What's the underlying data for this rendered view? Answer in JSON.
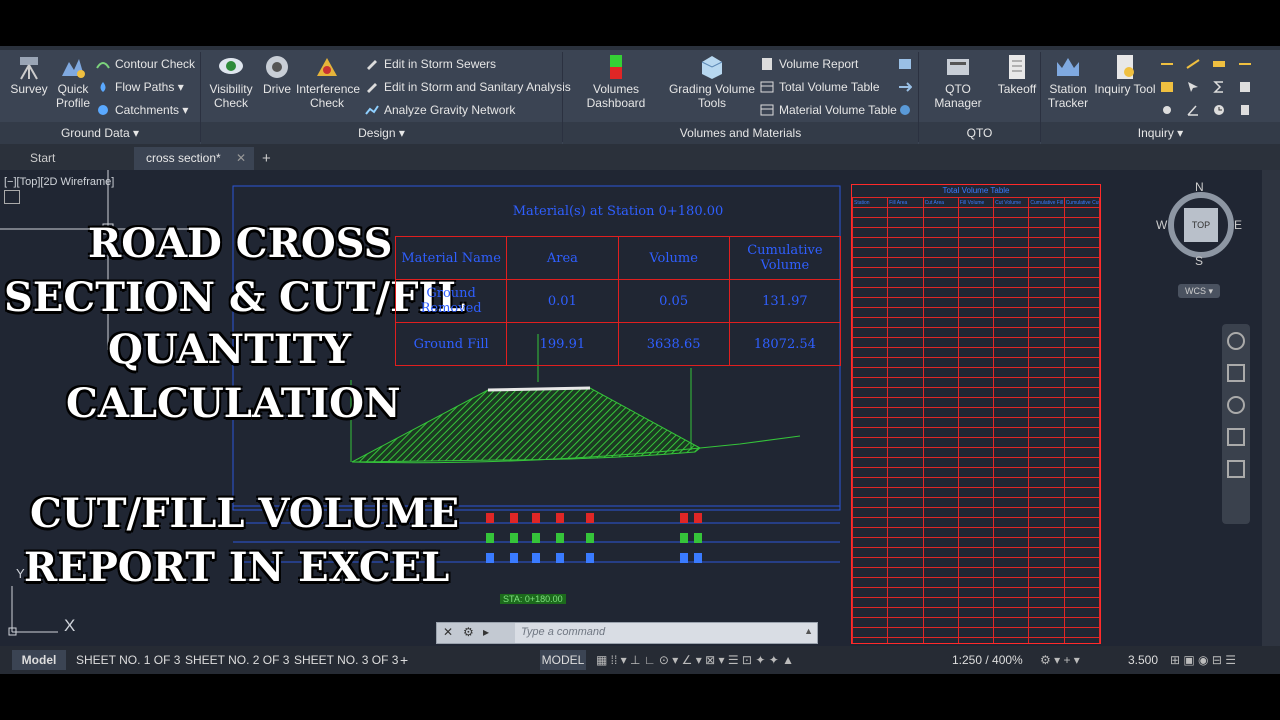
{
  "ribbon": {
    "ground_data": {
      "title": "Ground Data",
      "survey": "Survey",
      "quick_profile_1": "Quick",
      "quick_profile_2": "Profile",
      "contour_check": "Contour Check",
      "flow_paths": "Flow Paths",
      "catchments": "Catchments"
    },
    "design": {
      "title": "Design",
      "visibility_1": "Visibility",
      "visibility_2": "Check",
      "drive": "Drive",
      "interference_1": "Interference",
      "interference_2": "Check",
      "edit_storm_sewers": "Edit in Storm Sewers",
      "edit_storm_sanitary": "Edit in Storm and Sanitary Analysis",
      "analyze_gravity": "Analyze Gravity Network"
    },
    "volumes": {
      "title": "Volumes and Materials",
      "dashboard": "Volumes Dashboard",
      "grading_1": "Grading Volume",
      "grading_2": "Tools",
      "volume_report": "Volume Report",
      "total_volume_table": "Total Volume Table",
      "material_volume_table": "Material Volume Table"
    },
    "qto": {
      "title": "QTO",
      "manager": "QTO Manager",
      "takeoff": "Takeoff"
    },
    "inquiry": {
      "title": "Inquiry",
      "station_1": "Station",
      "station_2": "Tracker",
      "inquiry_tool": "Inquiry Tool"
    }
  },
  "file_tabs": {
    "start": "Start",
    "active": "cross section*"
  },
  "viewport": {
    "label": "[−][Top][2D Wireframe]",
    "axis_y": "Y",
    "axis_x": "X"
  },
  "overlay": {
    "line1": "ROAD CROSS",
    "line2": "SECTION & CUT/FIL",
    "line3": "QUANTITY",
    "line4": "CALCULATION",
    "line5": "CUT/FILL VOLUME",
    "line6": "REPORT IN EXCEL"
  },
  "viewcube": {
    "n": "N",
    "s": "S",
    "e": "E",
    "w": "W",
    "top": "TOP",
    "wcs": "WCS"
  },
  "material_table": {
    "title": "Material(s) at Station 0+180.00",
    "headers": [
      "Material Name",
      "Area",
      "Volume",
      "Cumulative Volume"
    ],
    "rows": [
      [
        "Ground Removed",
        "0.01",
        "0.05",
        "131.97"
      ],
      [
        "Ground Fill",
        "199.91",
        "3638.65",
        "18072.54"
      ]
    ]
  },
  "volume_table": {
    "title": "Total Volume Table",
    "headers": [
      "Station",
      "Fill Area",
      "Cut Area",
      "Fill Volume",
      "Cut Volume",
      "Cumulative Fill Vol",
      "Cumulative Cut Vol"
    ]
  },
  "drawing": {
    "station_label": "STA: 0+180.00",
    "green_tick": "0+180"
  },
  "command": {
    "placeholder": "Type a command"
  },
  "layout_tabs": [
    "Model",
    "SHEET NO. 1 OF 3",
    "SHEET NO. 2 OF 3",
    "SHEET NO. 3 OF 3"
  ],
  "status": {
    "model": "MODEL",
    "scale": "1:250 / 400%",
    "value": "3.500"
  },
  "colors": {
    "ribbon": "#3b4453",
    "canvas": "#202633",
    "table_border": "#e01f1f",
    "table_text": "#2f5fff",
    "fill_hatch": "#35c43a"
  }
}
